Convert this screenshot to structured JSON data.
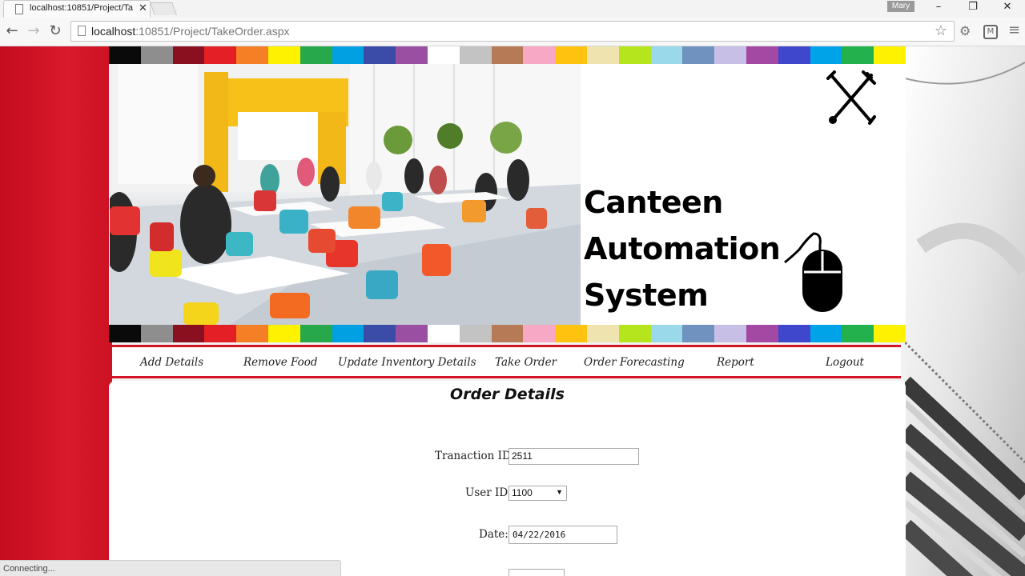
{
  "browser": {
    "tab_title": "localhost:10851/Project/Ta",
    "profile_name": "Mary",
    "url_host": "localhost",
    "url_rest": ":10851/Project/TakeOrder.aspx",
    "status_text": "Connecting..."
  },
  "header": {
    "title_line1": "Canteen",
    "title_line2": "Automation",
    "title_line3": "System",
    "stripe_colors": [
      "#0a0a0a",
      "#8e8e8e",
      "#8a1020",
      "#e41f26",
      "#f57f25",
      "#fff200",
      "#27a84a",
      "#00a0e3",
      "#3b4ba8",
      "#9b4fa3",
      "#ffffff",
      "#c3c3c3",
      "#b67a57",
      "#f7a8c4",
      "#fec20f",
      "#efe4b0",
      "#b5e61d",
      "#99d9ea",
      "#7092be",
      "#c8bfe7",
      "#a349a4",
      "#3f48cc",
      "#00a2e8",
      "#22b14c",
      "#fff200"
    ]
  },
  "menu": {
    "items": [
      "Add Details",
      "Remove Food",
      "Update Inventory Details",
      "Take Order",
      "Order Forecasting",
      "Report",
      "Logout"
    ]
  },
  "form": {
    "title": "Order Details",
    "transaction_label": "Tranaction ID:",
    "transaction_value": "2511",
    "user_label": "User ID:",
    "user_value": "1100",
    "date_label": "Date:",
    "date_value": "04/22/2016"
  }
}
